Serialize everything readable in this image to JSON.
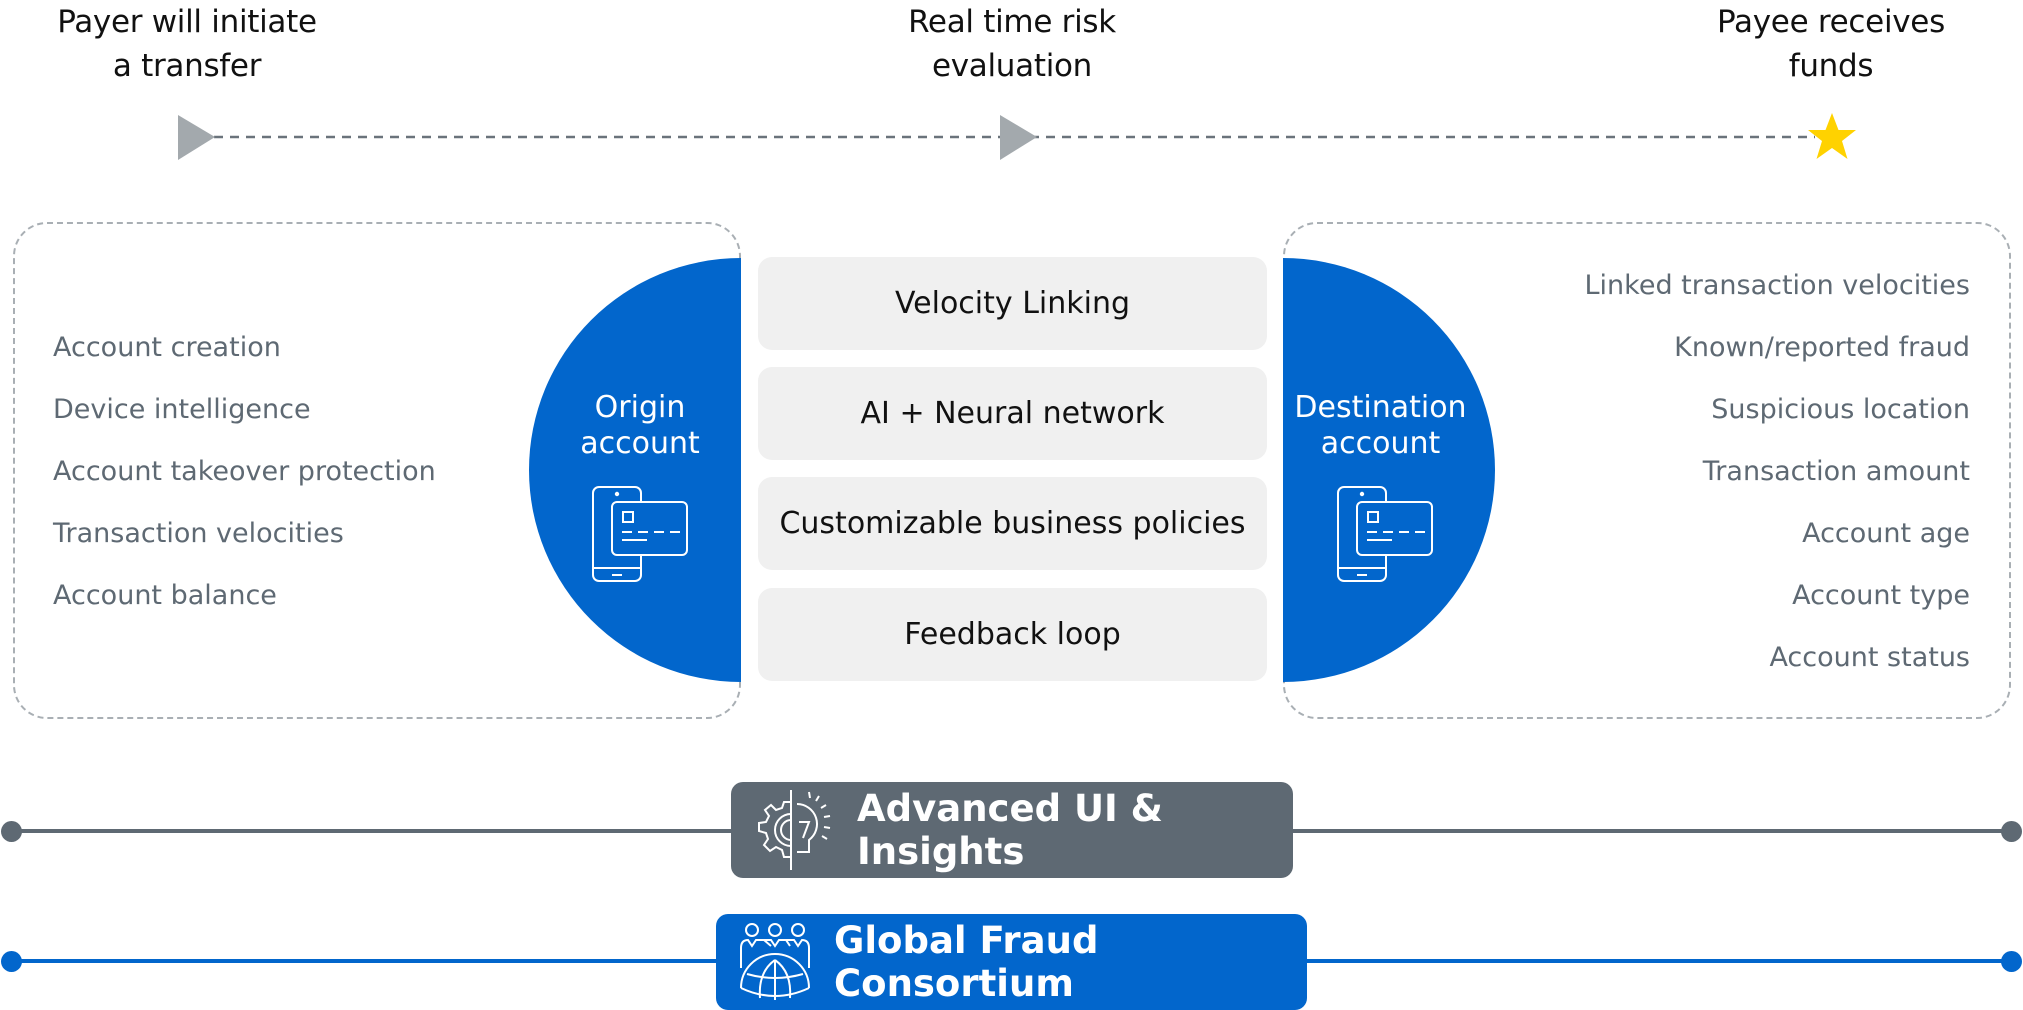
{
  "steps": [
    {
      "line1": "Payer will initiate",
      "line2": "a transfer",
      "marker": "triangle-play-icon"
    },
    {
      "line1": "Real time risk",
      "line2": "evaluation",
      "marker": "triangle-play-icon"
    },
    {
      "line1": "Payee receives",
      "line2": "funds",
      "marker": "star-icon"
    }
  ],
  "origin": {
    "label_line1": "Origin",
    "label_line2": "account",
    "icon": "phone-card-icon",
    "checks": [
      "Account creation",
      "Device intelligence",
      "Account takeover protection",
      "Transaction velocities",
      "Account balance"
    ]
  },
  "engine": {
    "items": [
      "Velocity Linking",
      "AI + Neural network",
      "Customizable business policies",
      "Feedback loop"
    ]
  },
  "destination": {
    "label_line1": "Destination",
    "label_line2": "account",
    "icon": "phone-card-icon",
    "checks": [
      "Linked transaction velocities",
      "Known/reported fraud",
      "Suspicious location",
      "Transaction amount",
      "Account age",
      "Account type",
      "Account status"
    ]
  },
  "bands": {
    "insights": {
      "label": "Advanced UI & Insights",
      "icon": "gear-lightbulb-icon"
    },
    "consortium": {
      "label": "Global Fraud Consortium",
      "icon": "people-globe-icon"
    }
  },
  "colors": {
    "brand_blue": "#0266cc",
    "slate": "#5e6973",
    "marker_gray": "#a3a9ad",
    "star_yellow": "#ffd200",
    "pill_bg": "#f0f0f0"
  }
}
